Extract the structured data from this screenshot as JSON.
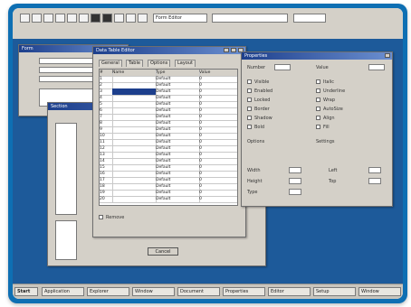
{
  "taskbar": {
    "start_label": "Start",
    "items": [
      "Application",
      "Explorer",
      "Window",
      "Document",
      "Properties",
      "Editor",
      "Setup",
      "Window"
    ]
  },
  "toolbar": {
    "search_value": "Form Editor",
    "tool_icons": [
      "new-icon",
      "open-icon",
      "save-icon",
      "cut-icon",
      "copy-icon",
      "paste-icon",
      "bold-icon",
      "italic-icon",
      "underline-icon",
      "align-icon",
      "color-icon"
    ]
  },
  "windows": {
    "back": {
      "title": "Form"
    },
    "middle": {
      "title": "Section",
      "button_label": "Cancel"
    },
    "table": {
      "title": "Data Table Editor",
      "tabs": [
        "General",
        "Table",
        "Options",
        "Layout"
      ],
      "columns": [
        "#",
        "Name",
        "Type",
        "Value"
      ],
      "rows": [
        [
          "1",
          "",
          "Default",
          "0"
        ],
        [
          "2",
          "",
          "Default",
          "0"
        ],
        [
          "3",
          "",
          "Default",
          "0"
        ],
        [
          "4",
          "",
          "Default",
          "0"
        ],
        [
          "5",
          "",
          "Default",
          "0"
        ],
        [
          "6",
          "",
          "Default",
          "0"
        ],
        [
          "7",
          "",
          "Default",
          "0"
        ],
        [
          "8",
          "",
          "Default",
          "0"
        ],
        [
          "9",
          "",
          "Default",
          "0"
        ],
        [
          "10",
          "",
          "Default",
          "0"
        ],
        [
          "11",
          "",
          "Default",
          "0"
        ],
        [
          "12",
          "",
          "Default",
          "0"
        ],
        [
          "13",
          "",
          "Default",
          "0"
        ],
        [
          "14",
          "",
          "Default",
          "0"
        ],
        [
          "15",
          "",
          "Default",
          "0"
        ],
        [
          "16",
          "",
          "Default",
          "0"
        ],
        [
          "17",
          "",
          "Default",
          "0"
        ],
        [
          "18",
          "",
          "Default",
          "0"
        ],
        [
          "19",
          "",
          "Default",
          "0"
        ],
        [
          "20",
          "",
          "Default",
          "0"
        ]
      ],
      "footer_label": "Remove"
    },
    "props": {
      "title": "Properties",
      "field_labels": [
        "Number",
        "Value"
      ],
      "group_labels": [
        "Options",
        "Settings"
      ],
      "check_labels": [
        "Visible",
        "Enabled",
        "Locked",
        "Border",
        "Shadow",
        "Bold",
        "Italic",
        "Underline",
        "Wrap",
        "AutoSize",
        "Align",
        "Fill"
      ],
      "bottom_labels": [
        "Width",
        "Height",
        "Left",
        "Top",
        "Type"
      ]
    }
  }
}
